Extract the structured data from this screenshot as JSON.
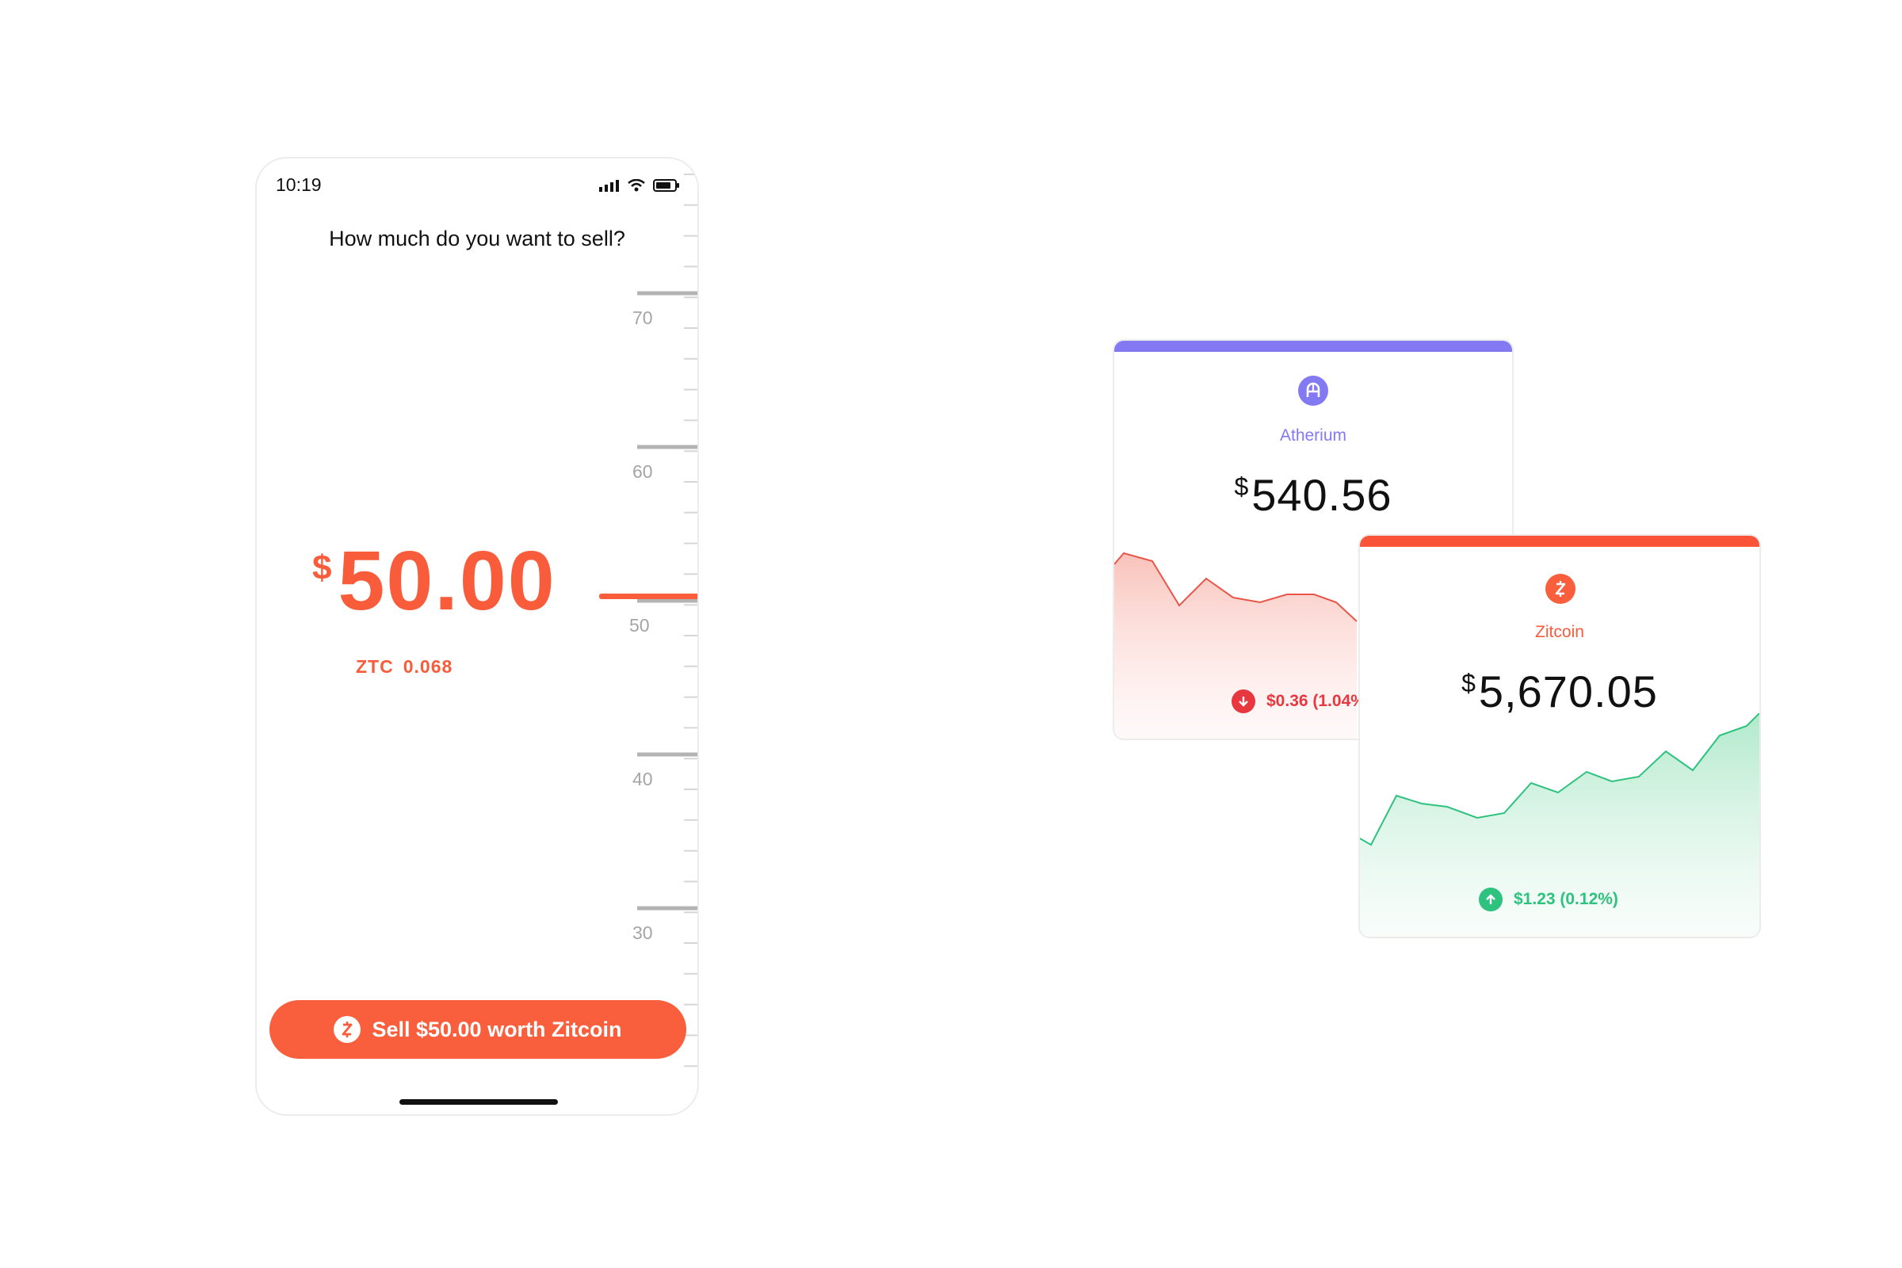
{
  "phone": {
    "status_time": "10:19",
    "question": "How much do you want to sell?",
    "ruler_labels": [
      "70",
      "60",
      "50",
      "40",
      "30"
    ],
    "amount_currency": "$",
    "amount_value": "50.00",
    "ztc_symbol": "ZTC",
    "ztc_amount": "0.068",
    "sell_button_label": "Sell $50.00 worth Zitcoin",
    "accent_color": "#f85c3a",
    "icons": {
      "signal": "signal-icon",
      "wifi": "wifi-icon",
      "battery": "battery-icon",
      "coin": "zitcoin-icon"
    }
  },
  "cards": {
    "atherium": {
      "name": "Atherium",
      "currency": "$",
      "price": "540.56",
      "change": "$0.36 (1.04%)",
      "direction": "down",
      "accent_color": "#8379f3",
      "change_color": "#e8383f",
      "icon": "atherium-icon"
    },
    "zitcoin": {
      "name": "Zitcoin",
      "currency": "$",
      "price": "5,670.05",
      "change": "$1.23 (0.12%)",
      "direction": "up",
      "accent_color": "#f85c3a",
      "change_color": "#2ec27e",
      "icon": "zitcoin-icon"
    }
  }
}
